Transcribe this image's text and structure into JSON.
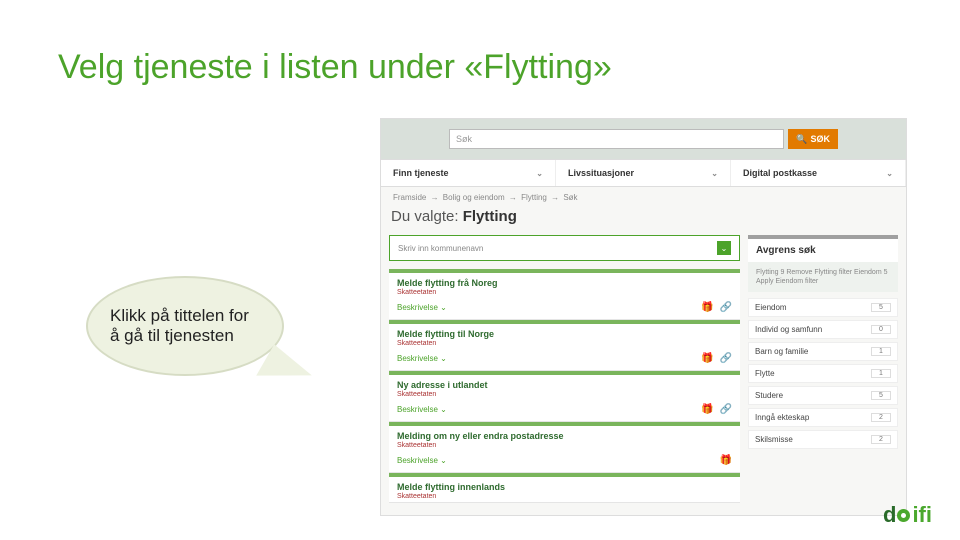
{
  "slide_title": "Velg tjeneste i listen under «Flytting»",
  "callout_text": "Klikk på tittelen for å gå til tjenesten",
  "logo_text": "ifi",
  "search": {
    "placeholder": "Søk",
    "button": "SØK"
  },
  "tabs": [
    {
      "label": "Finn tjeneste"
    },
    {
      "label": "Livssituasjoner"
    },
    {
      "label": "Digital postkasse"
    }
  ],
  "crumbs": [
    "Framside",
    "Bolig og eiendom",
    "Flytting",
    "Søk"
  ],
  "heading_prefix": "Du valgte:",
  "heading_value": "Flytting",
  "muni_placeholder": "Skriv inn kommunenavn",
  "cards": [
    {
      "title": "Melde flytting frå Noreg",
      "sub": "Skatteetaten",
      "desc": "Beskrivelse",
      "icons": [
        "gift",
        "link"
      ]
    },
    {
      "title": "Melde flytting til Norge",
      "sub": "Skatteetaten",
      "desc": "Beskrivelse",
      "icons": [
        "gift",
        "link"
      ]
    },
    {
      "title": "Ny adresse i utlandet",
      "sub": "Skatteetaten",
      "desc": "Beskrivelse",
      "icons": [
        "gift",
        "link"
      ]
    },
    {
      "title": "Melding om ny eller endra postadresse",
      "sub": "Skatteetaten",
      "desc": "Beskrivelse",
      "icons": [
        "gift"
      ]
    },
    {
      "title": "Melde flytting innenlands",
      "sub": "Skatteetaten",
      "desc": "",
      "icons": []
    }
  ],
  "aside": {
    "title": "Avgrens søk",
    "filters_text": "Flytting 9 Remove Flytting filter\nEiendom 5 Apply Eiendom filter",
    "rows": [
      {
        "label": "Eiendom",
        "count": "5"
      },
      {
        "label": "Individ og samfunn",
        "count": "0"
      },
      {
        "label": "Barn og familie",
        "count": "1"
      },
      {
        "label": "Flytte",
        "count": "1"
      },
      {
        "label": "Studere",
        "count": "5"
      },
      {
        "label": "Inngå ekteskap",
        "count": "2"
      },
      {
        "label": "Skilsmisse",
        "count": "2"
      }
    ]
  }
}
